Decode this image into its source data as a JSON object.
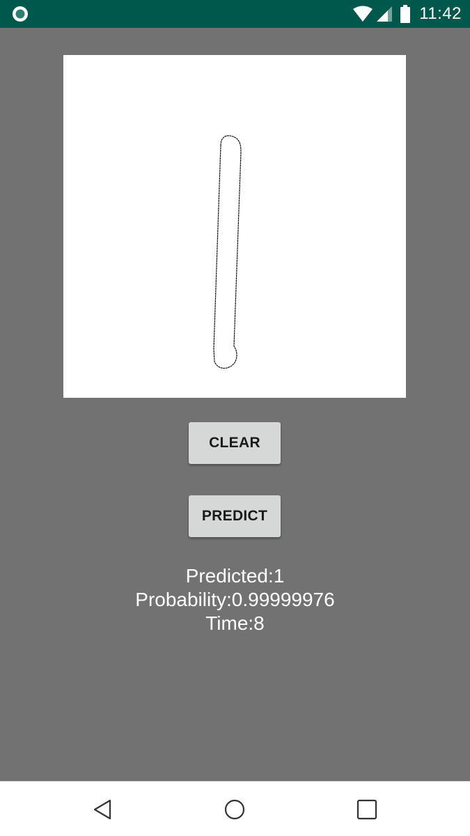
{
  "status_bar": {
    "time": "11:42",
    "icons": [
      "app-notification-icon",
      "wifi-icon",
      "cellular-signal-icon",
      "battery-icon"
    ],
    "background_color": "#00574b"
  },
  "canvas": {
    "background_color": "#ffffff",
    "drawn_content": "handwritten digit one"
  },
  "buttons": {
    "clear_label": "CLEAR",
    "predict_label": "PREDICT"
  },
  "result": {
    "predicted": "Predicted:1",
    "probability": "Probability:0.99999976",
    "time": "Time:8"
  },
  "nav_bar": {
    "icons": [
      "back-icon",
      "home-icon",
      "recents-icon"
    ]
  },
  "colors": {
    "background": "#727272",
    "button_face": "#d6d7d7",
    "result_text": "#ffffff"
  }
}
